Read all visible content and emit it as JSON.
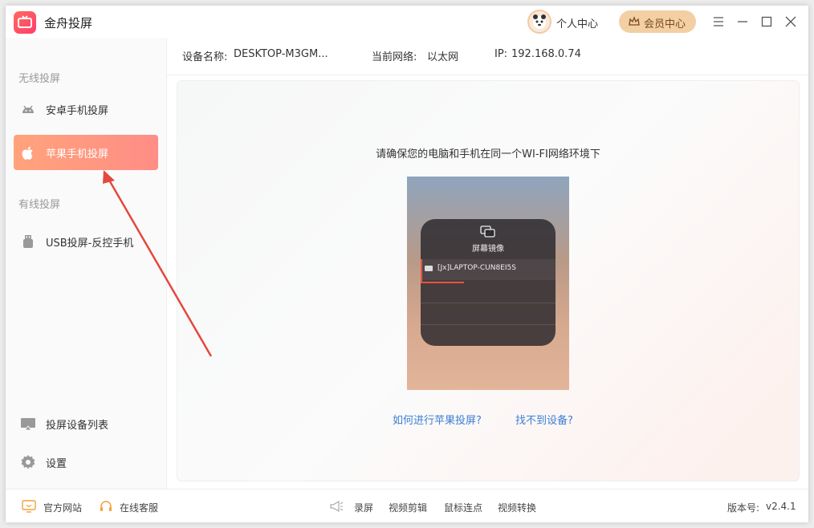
{
  "app": {
    "title": "金舟投屏",
    "personal_center": "个人中心",
    "vip_center": "会员中心"
  },
  "sidebar": {
    "wireless_title": "无线投屏",
    "wired_title": "有线投屏",
    "items": [
      {
        "label": "安卓手机投屏",
        "icon": "android-icon"
      },
      {
        "label": "苹果手机投屏",
        "icon": "apple-icon",
        "active": true
      },
      {
        "label": "USB投屏-反控手机",
        "icon": "usb-icon"
      },
      {
        "label": "投屏设备列表",
        "icon": "cast-device-icon"
      },
      {
        "label": "设置",
        "icon": "gear-icon"
      }
    ]
  },
  "device": {
    "name_label": "设备名称:",
    "name_value": "DESKTOP-M3GM...",
    "network_label": "当前网络:",
    "network_value": "以太网",
    "ip_label": "IP:",
    "ip_value": "192.168.0.74"
  },
  "main": {
    "tip": "请确保您的电脑和手机在同一个WI-FI网络环境下",
    "mirror_title": "屏幕镜像",
    "device_entry": "[Jx]LAPTOP-CUN8EI5S",
    "help_link": "如何进行苹果投屏?",
    "not_found_link": "找不到设备?"
  },
  "footer": {
    "website": "官方网站",
    "support": "在线客服",
    "tools": [
      "录屏",
      "视频剪辑",
      "鼠标连点",
      "视频转换"
    ],
    "version_label": "版本号:",
    "version_value": "v2.4.1"
  },
  "colors": {
    "accent": "#ff8f7f",
    "link": "#3c7fd4",
    "arrow": "#e4483d",
    "vip": "#f3cfa4"
  }
}
